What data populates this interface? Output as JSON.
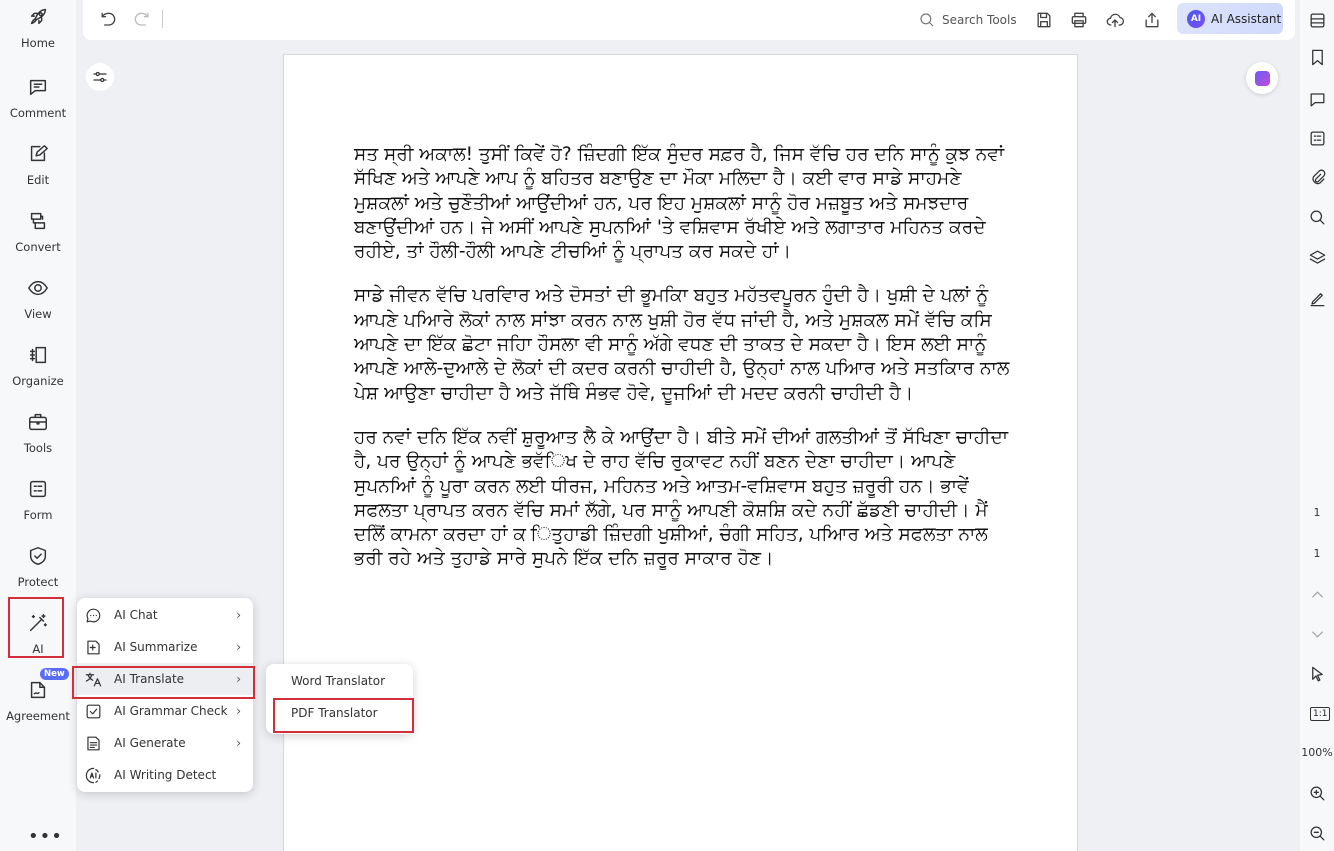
{
  "left_nav": [
    {
      "key": "home",
      "label": "Home",
      "icon": "rocket-icon"
    },
    {
      "key": "comment",
      "label": "Comment",
      "icon": "comment-icon"
    },
    {
      "key": "edit",
      "label": "Edit",
      "icon": "edit-icon"
    },
    {
      "key": "convert",
      "label": "Convert",
      "icon": "convert-icon"
    },
    {
      "key": "view",
      "label": "View",
      "icon": "eye-icon"
    },
    {
      "key": "organize",
      "label": "Organize",
      "icon": "organize-icon"
    },
    {
      "key": "tools",
      "label": "Tools",
      "icon": "toolbox-icon"
    },
    {
      "key": "form",
      "label": "Form",
      "icon": "form-icon"
    },
    {
      "key": "protect",
      "label": "Protect",
      "icon": "shield-icon"
    },
    {
      "key": "ai",
      "label": "AI",
      "icon": "magic-wand-icon"
    },
    {
      "key": "agreement",
      "label": "Agreement",
      "icon": "agreement-icon"
    }
  ],
  "new_badge": "New",
  "more_dots": "•••",
  "toolbar": {
    "search_tools": "Search Tools",
    "ai_assistant": "AI Assistant",
    "ai_logo": "AI"
  },
  "document": {
    "paragraphs": [
      "ਸਤ ਸ੍ਰੀ ਅਕਾਲ! ਤੁਸੀਂ ਕਿਵੇਂ ਹੋ? ਜ਼ਿੰਦਗੀ ਇੱਕ ਸੁੰਦਰ ਸਫ਼ਰ ਹੈ, ਜਿਸ ਵੱਚਿ ਹਰ ਦਨਿ ਸਾਨੂੰ ਕੁਝ ਨਵਾਂ ਸੱਖਿਣ ਅਤੇ ਆਪਣੇ ਆਪ ਨੂੰ ਬਹਿਤਰ ਬਣਾਉਣ ਦਾ ਮੌਕਾ ਮਲਿਦਾ ਹੈ। ਕਈ ਵਾਰ ਸਾਡੇ ਸਾਹਮਣੇ ਮੁਸ਼ਕਲਾਂ ਅਤੇ ਚੁਣੌਤੀਆਂ ਆਉਂਦੀਆਂ ਹਨ, ਪਰ ਇਹ ਮੁਸ਼ਕਲਾਂ ਸਾਨੂੰ ਹੋਰ ਮਜ਼ਬੂਤ ਅਤੇ ਸਮਝਦਾਰ ਬਣਾਉਂਦੀਆਂ ਹਨ। ਜੇ ਅਸੀਂ ਆਪਣੇ ਸੁਪਨਆਿਂ 'ਤੇ ਵਸ਼ਿਵਾਸ ਰੱਖੀਏ ਅਤੇ ਲਗਾਤਾਰ ਮਹਿਨਤ ਕਰਦੇ ਰਹੀਏ, ਤਾਂ ਹੌਲੀ-ਹੌਲੀ ਆਪਣੇ ਟੀਚਆਿਂ ਨੂੰ ਪ੍ਰਾਪਤ ਕਰ ਸਕਦੇ ਹਾਂ।",
      "ਸਾਡੇ ਜੀਵਨ ਵੱਚਿ ਪਰਵਿਾਰ ਅਤੇ ਦੋਸਤਾਂ ਦੀ ਭੂਮਕਿਾ ਬਹੁਤ ਮਹੱਤਵਪੂਰਨ ਹੁੰਦੀ ਹੈ। ਖੁਸ਼ੀ ਦੇ ਪਲਾਂ ਨੂੰ ਆਪਣੇ ਪਆਿਰੇ ਲੋਕਾਂ ਨਾਲ ਸਾਂਝਾ ਕਰਨ ਨਾਲ ਖੁਸ਼ੀ ਹੋਰ ਵੱਧ ਜਾਂਦੀ ਹੈ, ਅਤੇ ਮੁਸ਼ਕਲ ਸਮੇਂ ਵੱਚਿ ਕਸਿ ਆਪਣੇ ਦਾ ਇੱਕ ਛੋਟਾ ਜਹਿਾ ਹੌਸਲਾ ਵੀ ਸਾਨੂੰ ਅੱਗੇ ਵਧਣ ਦੀ ਤਾਕਤ ਦੇ ਸਕਦਾ ਹੈ। ਇਸ ਲਈ ਸਾਨੂੰ ਆਪਣੇ ਆਲੇ-ਦੁਆਲੇ ਦੇ ਲੋਕਾਂ ਦੀ ਕਦਰ ਕਰਨੀ ਚਾਹੀਦੀ ਹੈ, ਉਨ੍ਹਾਂ ਨਾਲ ਪਆਿਰ ਅਤੇ ਸਤਕਾਿਰ ਨਾਲ ਪੇਸ਼ ਆਉਣਾ ਚਾਹੀਦਾ ਹੈ ਅਤੇ ਜੱਥਿੇ ਸੰਭਵ ਹੋਵੇ, ਦੂਜਆਿਂ ਦੀ ਮਦਦ ਕਰਨੀ ਚਾਹੀਦੀ ਹੈ।",
      "ਹਰ ਨਵਾਂ ਦਨਿ ਇੱਕ ਨਵੀਂ ਸ਼ੁਰੂਆਤ ਲੈ ਕੇ ਆਉਂਦਾ ਹੈ। ਬੀਤੇ ਸਮੇਂ ਦੀਆਂ ਗਲਤੀਆਂ ਤੋਂ ਸੱਖਿਣਾ ਚਾਹੀਦਾ ਹੈ, ਪਰ ਉਨ੍ਹਾਂ ਨੂੰ ਆਪਣੇ ਭਵੱਿਖ ਦੇ ਰਾਹ ਵੱਚਿ ਰੁਕਾਵਟ ਨਹੀਂ ਬਣਨ ਦੇਣਾ ਚਾਹੀਦਾ। ਆਪਣੇ ਸੁਪਨਆਿਂ ਨੂੰ ਪੂਰਾ ਕਰਨ ਲਈ ਧੀਰਜ, ਮਹਿਨਤ ਅਤੇ ਆਤਮ-ਵਸ਼ਿਵਾਸ ਬਹੁਤ ਜ਼ਰੂਰੀ ਹਨ। ਭਾਵੇਂ ਸਫਲਤਾ ਪ੍ਰਾਪਤ ਕਰਨ ਵੱਚਿ ਸਮਾਂ ਲੱਗੇ, ਪਰ ਸਾਨੂੰ ਆਪਣੀ ਕੋਸ਼ਸ਼ਿ ਕਦੇ ਨਹੀਂ ਛੱਡਣੀ ਚਾਹੀਦੀ। ਮੈਂ ਦਲਿੋਂ ਕਾਮਨਾ ਕਰਦਾ ਹਾਂ ਕ ਿਤੁਹਾਡੀ ਜ਼ਿੰਦਗੀ ਖੁਸ਼ੀਆਂ, ਚੰਗੀ ਸਹਿਤ, ਪਆਿਰ ਅਤੇ ਸਫਲਤਾ ਨਾਲ ਭਰੀ ਰਹੇ ਅਤੇ ਤੁਹਾਡੇ ਸਾਰੇ ਸੁਪਨੇ ਇੱਕ ਦਨਿ ਜ਼ਰੂਰ ਸਾਕਾਰ ਹੋਣ।"
    ]
  },
  "right_bar": {
    "page_current": "1",
    "page_total": "1",
    "zoom_fit_label": "1:1",
    "zoom_level": "100%"
  },
  "ai_menu": {
    "items": [
      {
        "label": "AI Chat",
        "icon": "chat-bubble-icon",
        "has_submenu": true
      },
      {
        "label": "AI Summarize",
        "icon": "summarize-icon",
        "has_submenu": true
      },
      {
        "label": "AI Translate",
        "icon": "translate-icon",
        "has_submenu": true
      },
      {
        "label": "AI Grammar Check",
        "icon": "grammar-check-icon",
        "has_submenu": true
      },
      {
        "label": "AI Generate",
        "icon": "generate-icon",
        "has_submenu": true
      },
      {
        "label": "AI Writing Detect",
        "icon": "ai-detect-icon",
        "has_submenu": false
      }
    ],
    "arrow": "›"
  },
  "translate_submenu": {
    "items": [
      {
        "label": "Word Translator"
      },
      {
        "label": "PDF Translator"
      }
    ]
  },
  "colors": {
    "highlight_box": "#d32f3a",
    "accent": "#5b6cf7"
  }
}
